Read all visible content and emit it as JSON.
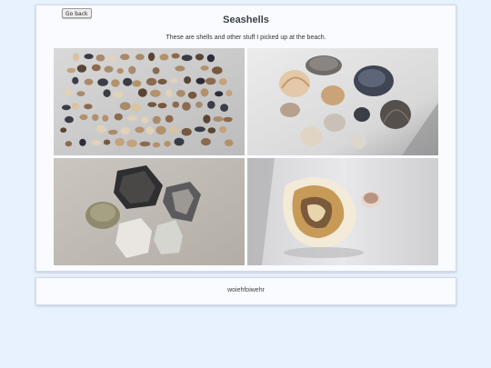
{
  "page": {
    "back_label": "Go back",
    "title": "Seashells",
    "subtitle": "These are shells and other stuff I picked up at the beach.",
    "footer_text": "woiehfoiwehr"
  },
  "colors": {
    "page_background": "#e8f2ff",
    "card_background": "#f9fbff",
    "title_color": "#3b3f4a"
  },
  "icons": []
}
